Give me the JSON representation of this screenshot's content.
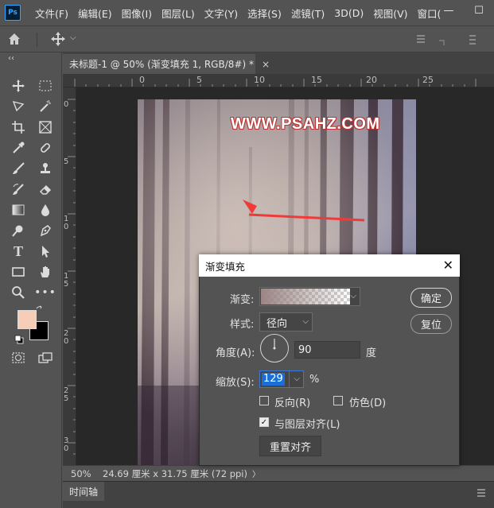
{
  "menu": {
    "logo": "Ps",
    "items": [
      "文件(F)",
      "编辑(E)",
      "图像(I)",
      "图层(L)",
      "文字(Y)",
      "选择(S)",
      "滤镜(T)",
      "3D(D)",
      "视图(V)",
      "窗口("
    ],
    "window_minimize": "—",
    "window_maximize": "☐"
  },
  "document_tab": {
    "title": "未标题-1 @ 50% (渐变填充 1, RGB/8#) *",
    "close": "×"
  },
  "ruler_top": {
    "labels": [
      "0",
      "5",
      "10",
      "15",
      "20",
      "25"
    ]
  },
  "ruler_left": {
    "labels": [
      "0",
      "5",
      "10",
      "15",
      "20",
      "25",
      "30"
    ]
  },
  "canvas": {
    "watermark": "WWW.PSAHZ.COM"
  },
  "status": {
    "zoom": "50%",
    "doc_size": "24.69 厘米 x 31.75 厘米 (72 ppi)",
    "arrow": "〉"
  },
  "timeline": {
    "tab_label": "时间轴"
  },
  "colors": {
    "foreground": "#f6cdb7",
    "background": "#000000",
    "dialog_title_bg": "#ffffff",
    "selection": "#1a6fd6"
  },
  "dialog": {
    "title": "渐变填充",
    "close": "✕",
    "gradient_label": "渐变:",
    "style_label": "样式:",
    "style_value": "径向",
    "angle_label": "角度(A):",
    "angle_value": "90",
    "angle_unit": "度",
    "scale_label": "缩放(S):",
    "scale_value": "129",
    "scale_unit": "%",
    "reverse_label": "反向(R)",
    "dither_label": "仿色(D)",
    "align_label": "与图层对齐(L)",
    "reset_align_button": "重置对齐",
    "ok_button": "确定",
    "cancel_button": "复位",
    "reverse_checked": false,
    "dither_checked": false,
    "align_checked": true
  }
}
